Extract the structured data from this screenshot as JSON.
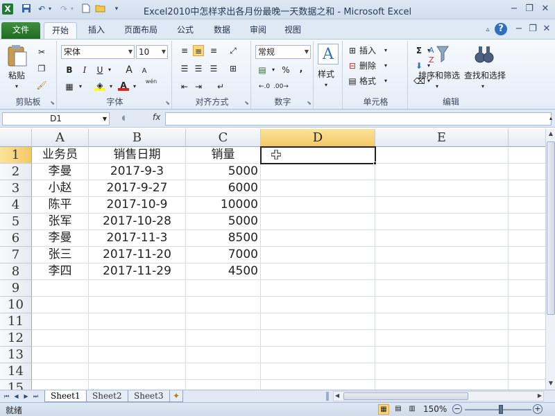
{
  "window": {
    "title": "Excel2010中怎样求出各月份最晚一天数据之和 - Microsoft Excel",
    "app_icon": "X",
    "minimize": "−",
    "restore": "❐",
    "close": "✕"
  },
  "ribbon_tabs": {
    "file": "文件",
    "home": "开始",
    "insert": "插入",
    "page_layout": "页面布局",
    "formulas": "公式",
    "data": "数据",
    "review": "审阅",
    "view": "视图"
  },
  "ribbon": {
    "clipboard": {
      "label": "剪贴板",
      "paste": "粘贴"
    },
    "font": {
      "label": "字体",
      "name": "宋体",
      "size": "10",
      "bold": "B",
      "italic": "I",
      "underline": "U",
      "grow": "A",
      "shrink": "A",
      "color_a": "A",
      "phonetic": "wén"
    },
    "alignment": {
      "label": "对齐方式"
    },
    "number": {
      "label": "数字",
      "format": "常规",
      "percent": "%",
      "comma": ","
    },
    "styles": {
      "label": "样式"
    },
    "cells": {
      "label": "单元格",
      "insert": "插入",
      "delete": "删除",
      "format": "格式"
    },
    "editing": {
      "label": "编辑",
      "sum": "Σ",
      "sort_filter": "排序和筛选",
      "find_select": "查找和选择"
    }
  },
  "formula_bar": {
    "name_box": "D1",
    "fx": "fx",
    "value": ""
  },
  "columns": [
    "A",
    "B",
    "C",
    "D",
    "E"
  ],
  "rows": [
    "1",
    "2",
    "3",
    "4",
    "5",
    "6",
    "7",
    "8",
    "9",
    "10",
    "11",
    "12",
    "13",
    "14",
    "15"
  ],
  "table": {
    "headers": [
      "业务员",
      "销售日期",
      "销量"
    ],
    "records": [
      [
        "李曼",
        "2017-9-3",
        "5000"
      ],
      [
        "小赵",
        "2017-9-27",
        "6000"
      ],
      [
        "陈平",
        "2017-10-9",
        "10000"
      ],
      [
        "张军",
        "2017-10-28",
        "5000"
      ],
      [
        "李曼",
        "2017-11-3",
        "8500"
      ],
      [
        "张三",
        "2017-11-20",
        "7000"
      ],
      [
        "李四",
        "2017-11-29",
        "4500"
      ]
    ]
  },
  "sheets": [
    "Sheet1",
    "Sheet2",
    "Sheet3"
  ],
  "status": {
    "ready": "就绪",
    "zoom": "150%"
  }
}
